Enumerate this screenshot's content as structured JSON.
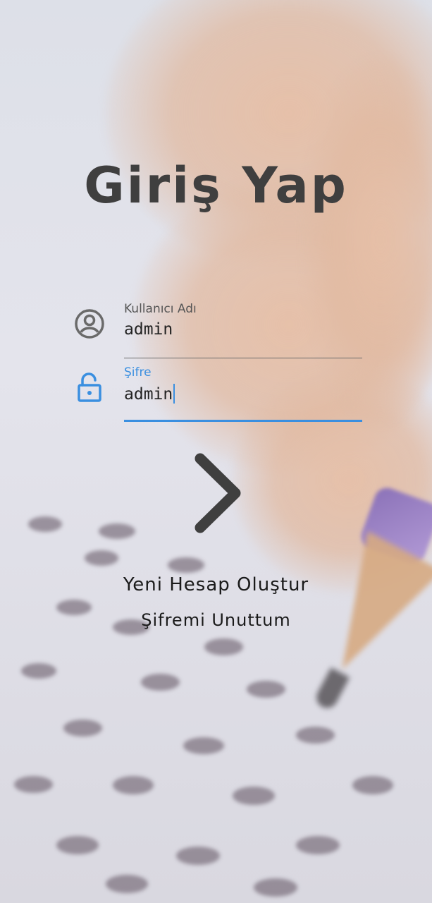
{
  "login": {
    "title": "Giriş Yap",
    "username": {
      "label": "Kullanıcı Adı",
      "value": "admin",
      "icon": "account-circle-icon"
    },
    "password": {
      "label": "Şifre",
      "value": "admin",
      "icon": "lock-open-icon"
    },
    "submit_icon": "chevron-right-icon",
    "create_account": "Yeni Hesap Oluştur",
    "forgot_password": "Şifremi Unuttum"
  },
  "colors": {
    "accent": "#3a8fe0",
    "text": "#3f3f3f",
    "icon_gray": "#6a6a6a"
  }
}
